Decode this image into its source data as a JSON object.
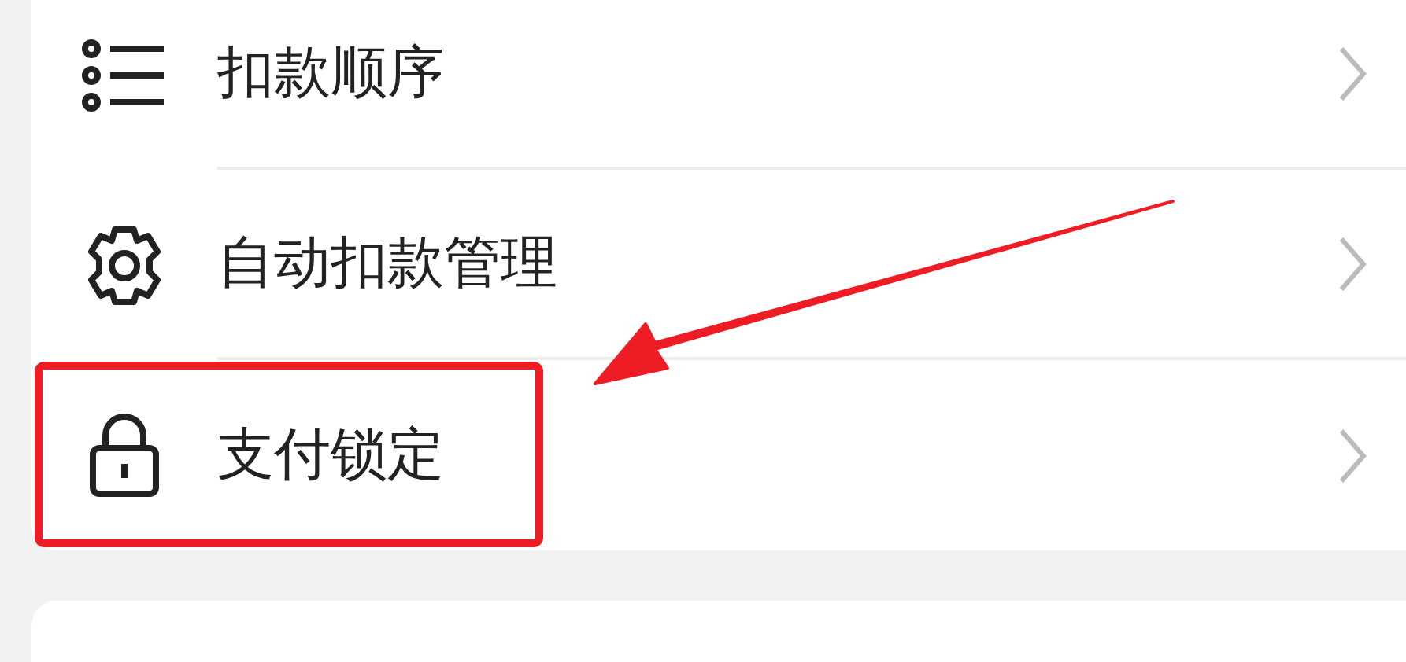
{
  "menu_items": [
    {
      "label": "扣款顺序",
      "highlighted": false
    },
    {
      "label": "自动扣款管理",
      "highlighted": false
    },
    {
      "label": "支付锁定",
      "highlighted": true
    }
  ]
}
